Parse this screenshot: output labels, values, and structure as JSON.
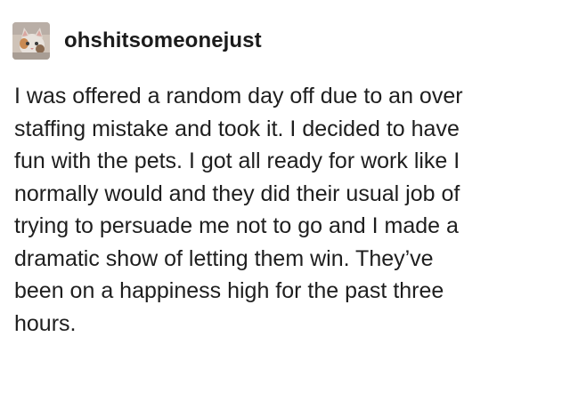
{
  "post": {
    "username": "ohshitsomeonejust",
    "avatar_icon": "cat-avatar-icon",
    "body_lines": [
      "I was offered a random day off due to an over",
      "staffing mistake and took it. I decided to have",
      "fun with the pets. I got all ready for work like I",
      "normally would and they did their usual job of",
      "trying to persuade me not to go and I made a",
      "dramatic show of letting them win. They’ve",
      "been on a happiness high for the past three",
      "hours."
    ]
  },
  "colors": {
    "background": "#ffffff",
    "text": "#1e1e1e"
  }
}
